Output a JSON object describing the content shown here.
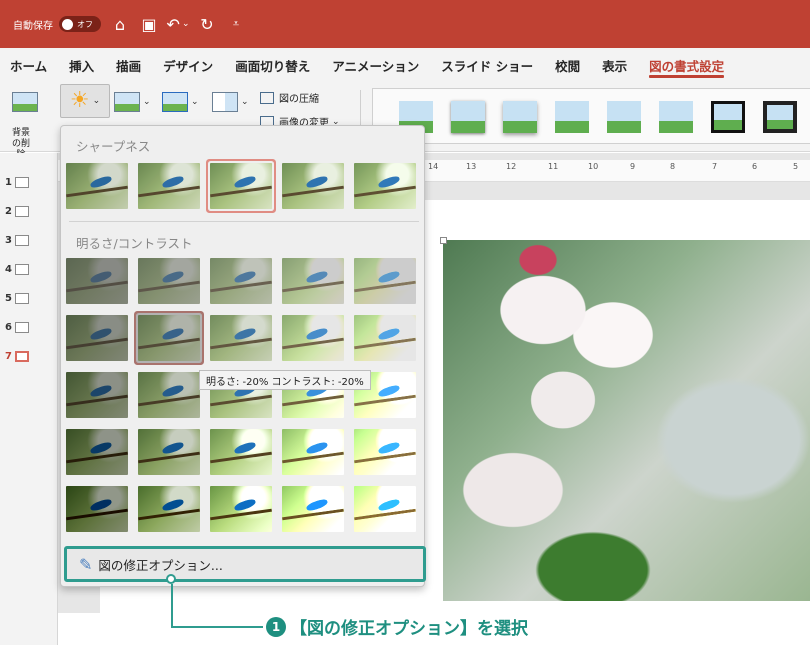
{
  "titlebar": {
    "autosave_label": "自動保存",
    "toggle_state": "オフ",
    "icons": [
      "home-icon",
      "save-icon",
      "undo-icon",
      "redo-icon",
      "customize-icon"
    ]
  },
  "tabs": [
    {
      "label": "ホーム"
    },
    {
      "label": "挿入"
    },
    {
      "label": "描画"
    },
    {
      "label": "デザイン"
    },
    {
      "label": "画面切り替え"
    },
    {
      "label": "アニメーション"
    },
    {
      "label": "スライド ショー"
    },
    {
      "label": "校閲"
    },
    {
      "label": "表示"
    },
    {
      "label": "図の書式設定",
      "active": true
    }
  ],
  "ribbon": {
    "bg_remove_label": "背景の削除",
    "compress_label": "図の圧縮",
    "change_label": "画像の変更"
  },
  "slides": [
    "1",
    "2",
    "3",
    "4",
    "5",
    "6",
    "7"
  ],
  "ruler": [
    "14",
    "13",
    "12",
    "11",
    "10",
    "9",
    "8",
    "7",
    "6",
    "5"
  ],
  "dropdown": {
    "sharpness_label": "シャープネス",
    "brightness_label": "明るさ/コントラスト",
    "tooltip": "明るさ: -20% コントラスト: -20%",
    "options_label": "図の修正オプション..."
  },
  "callout": {
    "number": "1",
    "text": "【図の修正オプション】を選択"
  },
  "colors": {
    "accent": "#bf4133",
    "highlight": "#2f9c8f",
    "callout_text": "#1e8f80"
  }
}
